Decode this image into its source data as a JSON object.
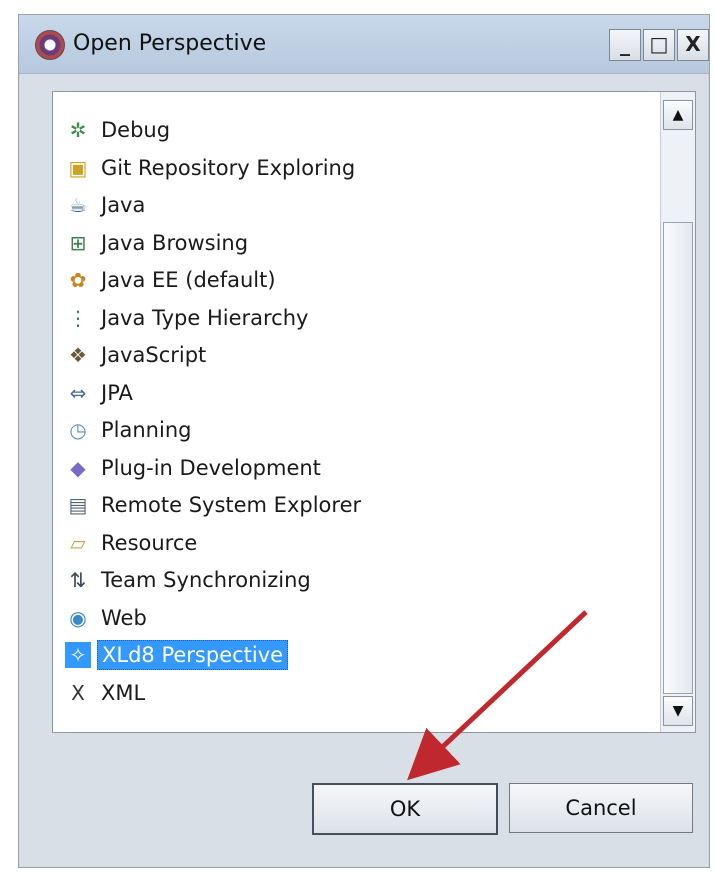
{
  "window": {
    "title": "Open Perspective",
    "controls": {
      "minimize": "_",
      "maximize": "□",
      "close": "X"
    }
  },
  "perspectives": [
    {
      "label": "Debug",
      "icon": "debug-icon"
    },
    {
      "label": "Git Repository Exploring",
      "icon": "git-icon"
    },
    {
      "label": "Java",
      "icon": "java-icon"
    },
    {
      "label": "Java Browsing",
      "icon": "java-browsing-icon"
    },
    {
      "label": "Java EE (default)",
      "icon": "java-ee-icon"
    },
    {
      "label": "Java Type Hierarchy",
      "icon": "type-hierarchy-icon"
    },
    {
      "label": "JavaScript",
      "icon": "javascript-icon"
    },
    {
      "label": "JPA",
      "icon": "jpa-icon"
    },
    {
      "label": "Planning",
      "icon": "planning-icon"
    },
    {
      "label": "Plug-in Development",
      "icon": "plugin-icon"
    },
    {
      "label": "Remote System Explorer",
      "icon": "remote-system-icon"
    },
    {
      "label": "Resource",
      "icon": "resource-folder-icon"
    },
    {
      "label": "Team Synchronizing",
      "icon": "team-sync-icon"
    },
    {
      "label": "Web",
      "icon": "web-globe-icon"
    },
    {
      "label": "XLd8 Perspective",
      "icon": "xld-icon",
      "selected": true
    },
    {
      "label": "XML",
      "icon": "xml-icon"
    }
  ],
  "buttons": {
    "ok": "OK",
    "cancel": "Cancel"
  },
  "colors": {
    "selection": "#3399ff",
    "annotation_arrow": "#c0282d"
  }
}
